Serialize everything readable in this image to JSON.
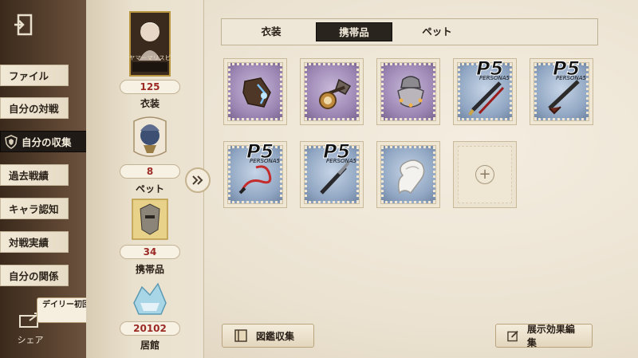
{
  "nav": {
    "items": [
      {
        "label": "ファイル"
      },
      {
        "label": "自分の対戦"
      },
      {
        "label": "自分の収集",
        "active": true
      },
      {
        "label": "過去戦績"
      },
      {
        "label": "キャラ認知"
      },
      {
        "label": "対戦実績"
      },
      {
        "label": "自分の関係"
      }
    ],
    "share_label": "シェア",
    "daily_tip": "デイリー初回シェア"
  },
  "stats": [
    {
      "value": "125",
      "label": "衣装",
      "card_caption": "ヤマーマリスピ"
    },
    {
      "value": "8",
      "label": "ペット"
    },
    {
      "value": "34",
      "label": "携帯品"
    },
    {
      "value": "20102",
      "label": "居館"
    }
  ],
  "tabs": [
    "衣装",
    "携帯品",
    "ペット"
  ],
  "active_tab": "携帯品",
  "items": [
    {
      "kind": "purple",
      "icon": "gauntlet-icon"
    },
    {
      "kind": "purple",
      "icon": "compass-axe-icon"
    },
    {
      "kind": "purple",
      "icon": "lantern-charm-icon"
    },
    {
      "kind": "blue",
      "icon": "sword-icon",
      "badge": "P5 PERSONA5"
    },
    {
      "kind": "blue",
      "icon": "shotgun-icon",
      "badge": "P5 PERSONA5"
    },
    {
      "kind": "blue",
      "icon": "whip-icon",
      "badge": "P5 PERSONA5"
    },
    {
      "kind": "blue",
      "icon": "knife-icon",
      "badge": "P5 PERSONA5"
    },
    {
      "kind": "blue",
      "icon": "scarf-icon"
    },
    {
      "kind": "empty",
      "icon": "plus-icon"
    }
  ],
  "bottom": {
    "left_button": "図鑑収集",
    "right_button": "展示効果編集"
  },
  "colors": {
    "value_red": "#9b2b24",
    "active_dark": "#2a241f",
    "paper": "#ebe2d1"
  }
}
